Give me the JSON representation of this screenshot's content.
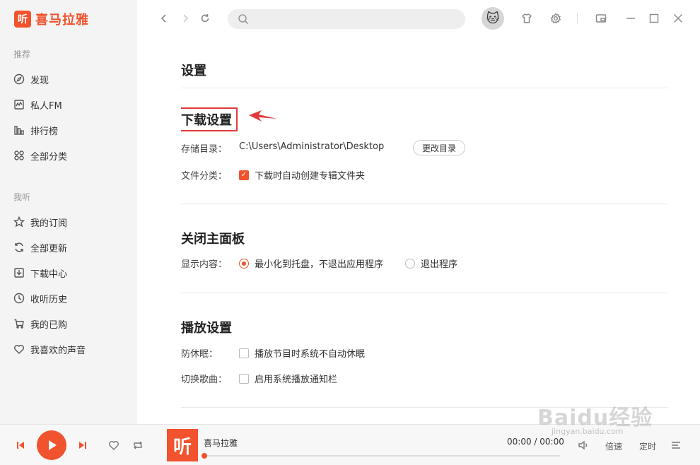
{
  "app": {
    "logo_glyph": "听",
    "name": "喜马拉雅"
  },
  "sidebar": {
    "section1": "推荐",
    "items1": [
      {
        "label": "发现",
        "icon": "compass-icon"
      },
      {
        "label": "私人FM",
        "icon": "radio-wave-icon"
      },
      {
        "label": "排行榜",
        "icon": "bar-chart-icon"
      },
      {
        "label": "全部分类",
        "icon": "grid-icon"
      }
    ],
    "section2": "我听",
    "items2": [
      {
        "label": "我的订阅",
        "icon": "star-icon"
      },
      {
        "label": "全部更新",
        "icon": "refresh-icon"
      },
      {
        "label": "下载中心",
        "icon": "download-icon"
      },
      {
        "label": "收听历史",
        "icon": "clock-icon"
      },
      {
        "label": "我的已购",
        "icon": "cart-icon"
      },
      {
        "label": "我喜欢的声音",
        "icon": "heart-icon"
      }
    ]
  },
  "topbar": {
    "search_placeholder": "",
    "avatar": "🐱"
  },
  "settings": {
    "title": "设置",
    "download": {
      "title": "下载设置",
      "dir_label": "存储目录：",
      "dir_value": "C:\\Users\\Administrator\\Desktop",
      "change_btn": "更改目录",
      "classify_label": "文件分类：",
      "classify_option": "下载时自动创建专辑文件夹",
      "classify_checked": true
    },
    "close_panel": {
      "title": "关闭主面板",
      "label": "显示内容：",
      "option1": "最小化到托盘，不退出应用程序",
      "option2": "退出程序",
      "selected": "option1"
    },
    "playback": {
      "title": "播放设置",
      "sleep_label": "防休眠：",
      "sleep_option": "播放节目时系统不自动休眠",
      "switch_label": "切换歌曲：",
      "switch_option": "启用系统播放通知栏"
    }
  },
  "player": {
    "cover_glyph": "听",
    "track": "喜马拉雅",
    "time": "00:00 / 00:00",
    "progress": 0,
    "speed": "倍速",
    "timer": "定时"
  },
  "watermark": {
    "text": "Baidu经验",
    "sub": "jingyan.baidu.com"
  },
  "colors": {
    "accent": "#f0532d",
    "highlight_box": "#e03b3b"
  }
}
